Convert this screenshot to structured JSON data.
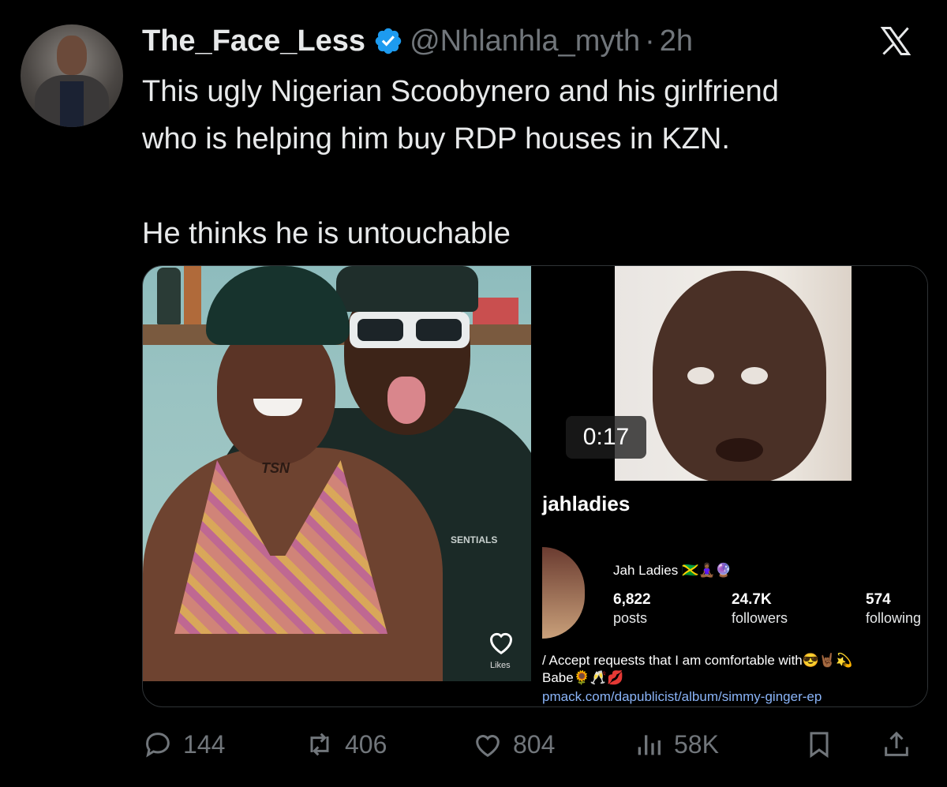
{
  "author": {
    "name": "The_Face_Less",
    "handle": "@Nhlanhla_myth",
    "separator": "·",
    "time": "2h"
  },
  "tweet": {
    "line1": "This ugly  Nigerian Scoobynero and his girlfriend",
    "line2": "who is helping him buy RDP houses in KZN.",
    "line3": "He thinks he is untouchable"
  },
  "media": {
    "left_photo": {
      "tattoo_text": "TSN",
      "shirt_text": "SENTIALS",
      "likes_label": "Likes"
    },
    "video": {
      "duration": "0:17"
    },
    "profile": {
      "username": "jahladies",
      "display_name": "Jah Ladies 🇯🇲🧘🏾‍♀️🔮",
      "posts_count": "6,822",
      "posts_label": "posts",
      "followers_count": "24.7K",
      "followers_label": "followers",
      "following_count": "574",
      "following_label": "following",
      "bio_line1": "/ Accept requests that I am comfortable with😎🤘🏾💫",
      "bio_line2": "Babe🌻🥂💋",
      "bio_link": "pmack.com/dapublicist/album/simmy-ginger-ep"
    }
  },
  "actions": {
    "replies": "144",
    "reposts": "406",
    "likes": "804",
    "views": "58K"
  },
  "colors": {
    "background": "#000000",
    "text": "#e7e9ea",
    "muted": "#71767b",
    "verified": "#1d9bf0"
  },
  "icons": [
    "verified-badge-icon",
    "x-logo-icon",
    "reply-icon",
    "repost-icon",
    "like-icon",
    "views-icon",
    "bookmark-icon",
    "share-icon"
  ]
}
